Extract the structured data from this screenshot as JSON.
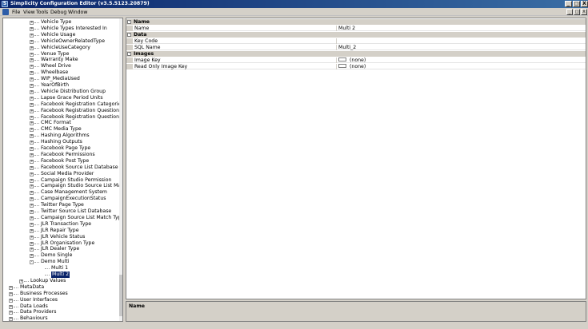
{
  "window": {
    "title": "Simplicity Configuration Editor (v3.5.5123.20879)",
    "minimize": "_",
    "maximize": "□",
    "close": "X"
  },
  "menu": {
    "items": [
      "File",
      "View",
      "Tools",
      "Debug",
      "Window"
    ]
  },
  "tree": {
    "rows": [
      {
        "label": "Vehicle Type",
        "level": 2,
        "expander": "+"
      },
      {
        "label": "Vehicle Types Interested In",
        "level": 2,
        "expander": "+"
      },
      {
        "label": "Vehicle Usage",
        "level": 2,
        "expander": "+"
      },
      {
        "label": "VehicleOwnerRelatedType",
        "level": 2,
        "expander": "+"
      },
      {
        "label": "VehicleUseCategory",
        "level": 2,
        "expander": "+"
      },
      {
        "label": "Venue Type",
        "level": 2,
        "expander": "+"
      },
      {
        "label": "Warranty Make",
        "level": 2,
        "expander": "+"
      },
      {
        "label": "Wheel Drive",
        "level": 2,
        "expander": "+"
      },
      {
        "label": "Wheelbase",
        "level": 2,
        "expander": "+"
      },
      {
        "label": "WIP_MediaUsed",
        "level": 2,
        "expander": "+"
      },
      {
        "label": "YearOfBirth",
        "level": 2,
        "expander": "+"
      },
      {
        "label": "Vehicle Distribution Group",
        "level": 2,
        "expander": "+"
      },
      {
        "label": "Lapse Grace Period Units",
        "level": 2,
        "expander": "+"
      },
      {
        "label": "Facebook Registration Categories",
        "level": 2,
        "expander": "+"
      },
      {
        "label": "Facebook Registration Question Types",
        "level": 2,
        "expander": "+"
      },
      {
        "label": "Facebook Registration Question View",
        "level": 2,
        "expander": "+"
      },
      {
        "label": "CMC Format",
        "level": 2,
        "expander": "+"
      },
      {
        "label": "CMC Media Type",
        "level": 2,
        "expander": "+"
      },
      {
        "label": "Hashing Algorithms",
        "level": 2,
        "expander": "+"
      },
      {
        "label": "Hashing Outputs",
        "level": 2,
        "expander": "+"
      },
      {
        "label": "Facebook Page Type",
        "level": 2,
        "expander": "+"
      },
      {
        "label": "Facebook Permissions",
        "level": 2,
        "expander": "+"
      },
      {
        "label": "Facebook Post Type",
        "level": 2,
        "expander": "+"
      },
      {
        "label": "Facebook Source List Database",
        "level": 2,
        "expander": "+"
      },
      {
        "label": "Social Media Provider",
        "level": 2,
        "expander": "+"
      },
      {
        "label": "Campaign Studio Permission",
        "level": 2,
        "expander": "+"
      },
      {
        "label": "Campaign Studio Source List Match Type",
        "level": 2,
        "expander": "+"
      },
      {
        "label": "Case Management System",
        "level": 2,
        "expander": "+"
      },
      {
        "label": "CampaignExecutionStatus",
        "level": 2,
        "expander": "+"
      },
      {
        "label": "Twitter Page Type",
        "level": 2,
        "expander": "+"
      },
      {
        "label": "Twitter Source List Database",
        "level": 2,
        "expander": "+"
      },
      {
        "label": "Campaign Source List Match Type",
        "level": 2,
        "expander": "+"
      },
      {
        "label": "JLR Transaction Type",
        "level": 2,
        "expander": "+"
      },
      {
        "label": "JLR Repair Type",
        "level": 2,
        "expander": "+"
      },
      {
        "label": "JLR Vehicle Status",
        "level": 2,
        "expander": "+"
      },
      {
        "label": "JLR Organisation Type",
        "level": 2,
        "expander": "+"
      },
      {
        "label": "JLR Dealer Type",
        "level": 2,
        "expander": "+"
      },
      {
        "label": "Demo Single",
        "level": 2,
        "expander": "+"
      },
      {
        "label": "Demo Multi",
        "level": 2,
        "expander": "-"
      },
      {
        "label": "Multi 1",
        "level": 3,
        "expander": ""
      },
      {
        "label": "Multi 2",
        "level": 3,
        "expander": "",
        "selected": true
      },
      {
        "label": "Lookup Values",
        "level": 1,
        "expander": "+"
      },
      {
        "label": "MetaData",
        "level": 0,
        "expander": "+"
      },
      {
        "label": "Business Processes",
        "level": 0,
        "expander": "+"
      },
      {
        "label": "User Interfaces",
        "level": 0,
        "expander": "+"
      },
      {
        "label": "Data Loads",
        "level": 0,
        "expander": "+"
      },
      {
        "label": "Data Providers",
        "level": 0,
        "expander": "+"
      },
      {
        "label": "Behaviours",
        "level": 0,
        "expander": "+"
      }
    ]
  },
  "properties": {
    "categories": [
      {
        "label": "Name",
        "toggle": "-",
        "rows": [
          {
            "name": "Name",
            "value": "Multi 2",
            "swatch": false
          }
        ]
      },
      {
        "label": "Data",
        "toggle": "-",
        "rows": [
          {
            "name": "Key Code",
            "value": "",
            "swatch": false
          },
          {
            "name": "SQL Name",
            "value": "Multi_2",
            "swatch": false
          }
        ]
      },
      {
        "label": "Images",
        "toggle": "-",
        "rows": [
          {
            "name": "Image Key",
            "value": "(none)",
            "swatch": true
          },
          {
            "name": "Read Only Image Key",
            "value": "(none)",
            "swatch": true
          }
        ]
      }
    ]
  },
  "description": {
    "title": "Name"
  }
}
